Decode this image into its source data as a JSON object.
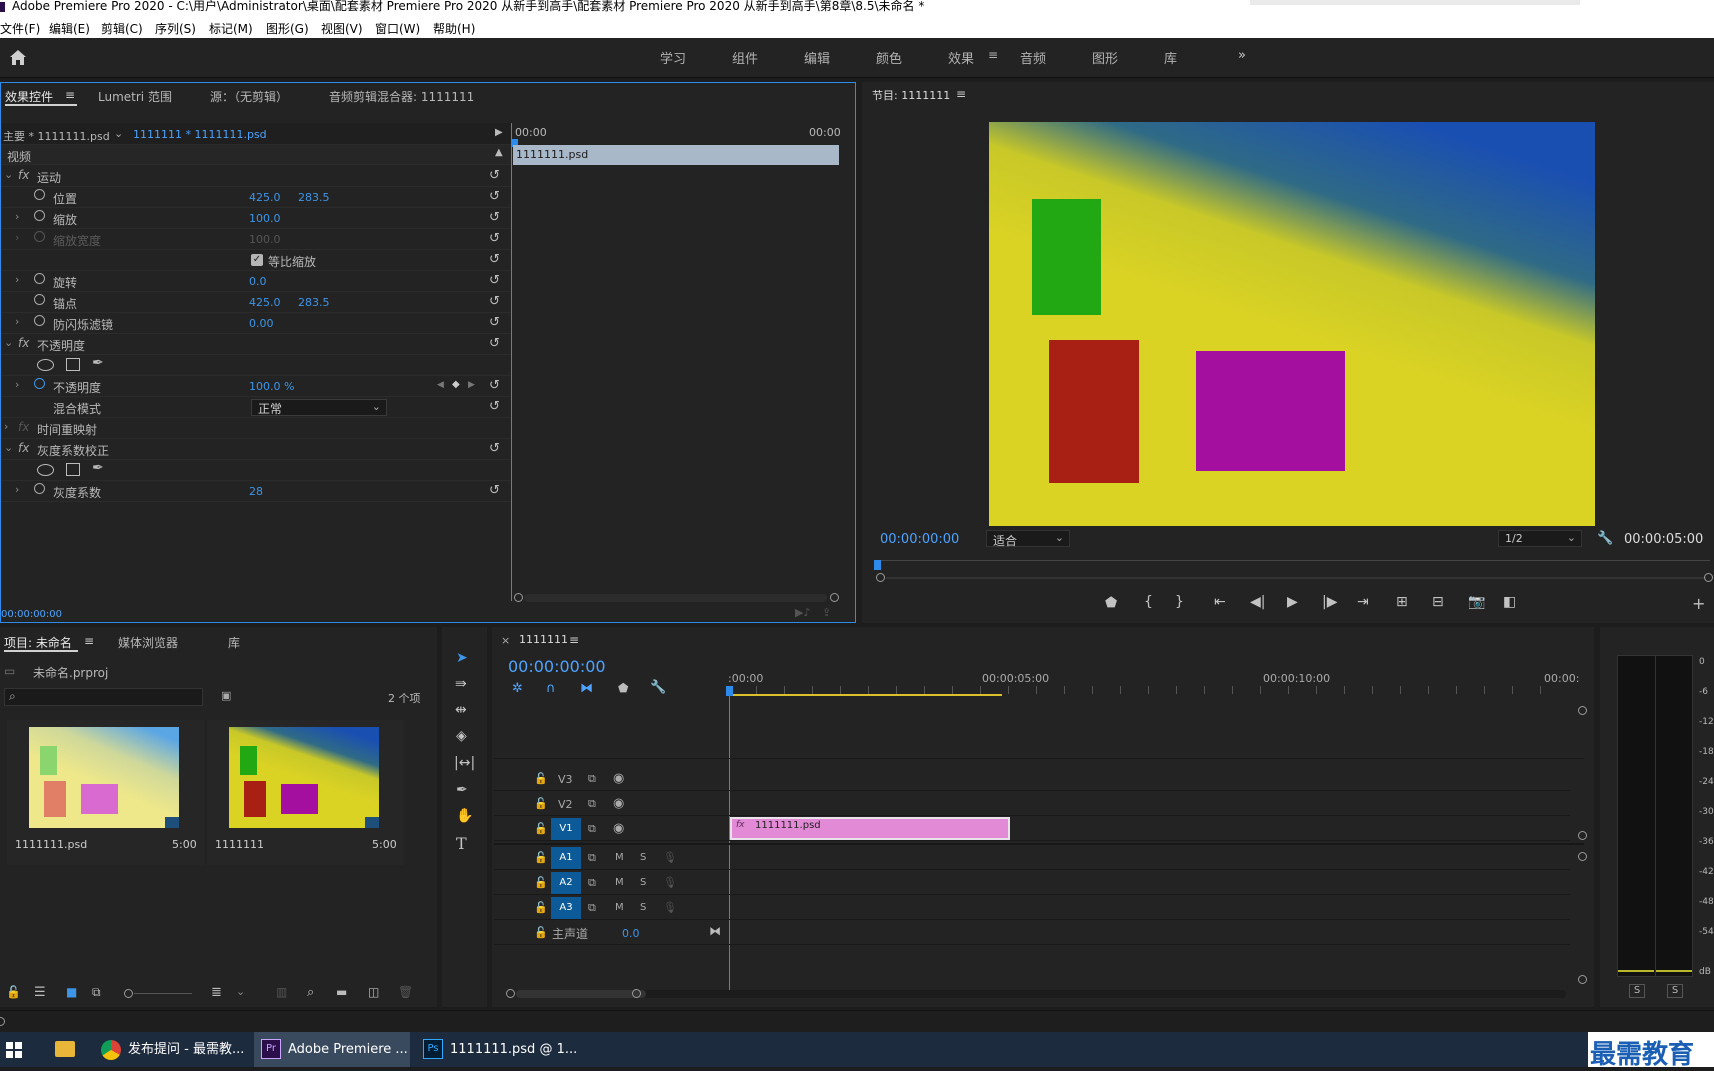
{
  "window": {
    "title": "Adobe Premiere Pro 2020 - C:\\用户\\Administrator\\桌面\\配套素材 Premiere Pro 2020 从新手到高手\\配套素材 Premiere Pro 2020 从新手到高手\\第8章\\8.5\\未命名 *"
  },
  "menu": [
    "文件(F)",
    "编辑(E)",
    "剪辑(C)",
    "序列(S)",
    "标记(M)",
    "图形(G)",
    "视图(V)",
    "窗口(W)",
    "帮助(H)"
  ],
  "workspaces": [
    "学习",
    "组件",
    "编辑",
    "颜色",
    "效果",
    "音频",
    "图形",
    "库"
  ],
  "workspace_active": "效果",
  "effect_controls": {
    "tabs": [
      "效果控件",
      "Lumetri 范围",
      "源：（无剪辑）",
      "音频剪辑混合器: 1111111"
    ],
    "master": "主要 * 1111111.psd",
    "sequence_clip": "1111111 * 1111111.psd",
    "ruler_start": "00:00",
    "ruler_end": "00:00",
    "clip_name": "1111111.psd",
    "section_video": "视频",
    "motion": "运动",
    "position": {
      "label": "位置",
      "x": "425.0",
      "y": "283.5"
    },
    "scale": {
      "label": "缩放",
      "value": "100.0"
    },
    "scale_width": {
      "label": "缩放宽度",
      "value": "100.0"
    },
    "uniform": "等比缩放",
    "rotation": {
      "label": "旋转",
      "value": "0.0"
    },
    "anchor": {
      "label": "锚点",
      "x": "425.0",
      "y": "283.5"
    },
    "flicker": {
      "label": "防闪烁滤镜",
      "value": "0.00"
    },
    "opacity_section": "不透明度",
    "opacity": {
      "label": "不透明度",
      "value": "100.0 %"
    },
    "blend": {
      "label": "混合模式",
      "value": "正常"
    },
    "time_remap": "时间重映射",
    "gamma_section": "灰度系数校正",
    "gamma": {
      "label": "灰度系数",
      "value": "28"
    },
    "timecode": "00:00:00:00"
  },
  "program": {
    "title": "节目: 1111111",
    "timecode": "00:00:00:00",
    "fit": "适合",
    "resolution": "1/2",
    "duration": "00:00:05:00"
  },
  "project": {
    "tabs": [
      "项目: 未命名",
      "媒体浏览器",
      "库"
    ],
    "file": "未命名.prproj",
    "count": "2 个项",
    "items": [
      {
        "name": "1111111.psd",
        "duration": "5:00"
      },
      {
        "name": "1111111",
        "duration": "5:00"
      }
    ]
  },
  "timeline": {
    "tab": "1111111",
    "timecode": "00:00:00:00",
    "ruler": [
      ":00:00",
      "00:00:05:00",
      "00:00:10:00",
      "00:00:"
    ],
    "video_tracks": [
      "V3",
      "V2",
      "V1"
    ],
    "audio_tracks": [
      "A1",
      "A2",
      "A3"
    ],
    "master": "主声道",
    "master_value": "0.0",
    "clip": "1111111.psd",
    "mute": "M",
    "solo": "S"
  },
  "meter": {
    "scale": [
      "0",
      "-6",
      "-12",
      "-18",
      "-24",
      "-30",
      "-36",
      "-42",
      "-48",
      "-54",
      "dB"
    ],
    "solo": [
      "S",
      "S"
    ]
  },
  "taskbar": {
    "items": [
      "发布提问 - 最需教...",
      "Adobe Premiere ...",
      "1111111.psd @ 1..."
    ]
  },
  "watermark": "最需教育",
  "colors": {
    "accent": "#2d8ceb",
    "bg": "#232323",
    "clip_pink": "#e28ad6",
    "frame_yellow": "#dbd324",
    "frame_blue": "#1a4fb2",
    "green": "#21a813",
    "red": "#a81f14",
    "magenta": "#a50fa0"
  }
}
